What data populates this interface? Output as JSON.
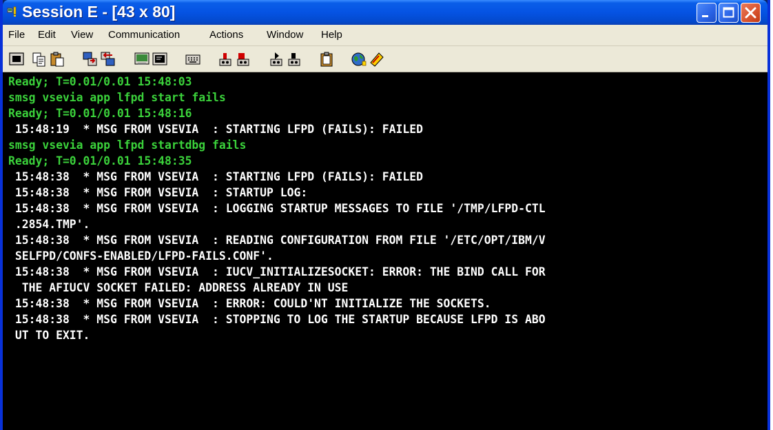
{
  "window": {
    "title": "Session E - [43 x 80]",
    "colors": {
      "title_bar": "#0553e3",
      "terminal_bg": "#000000",
      "terminal_green": "#3bd23b",
      "terminal_white": "#ffffff",
      "close_button": "#d8532e"
    }
  },
  "menu": {
    "items": [
      "File",
      "Edit",
      "View",
      "Communication",
      "Actions",
      "Window",
      "Help"
    ]
  },
  "toolbar": {
    "icons": [
      "display-icon",
      "copy-icon",
      "paste-icon",
      "send-icon",
      "receive-icon",
      "screen-setup-icon",
      "screen-icon",
      "keyboard-map-icon",
      "start-record-icon",
      "stop-record-icon",
      "play-macro-icon",
      "record-macro-icon",
      "clipboard-icon",
      "globe-icon",
      "help-icon"
    ]
  },
  "terminal": {
    "lines": [
      {
        "text": "Ready; T=0.01/0.01 15:48:03",
        "color": "green"
      },
      {
        "text": "smsg vsevia app lfpd start fails",
        "color": "green"
      },
      {
        "text": "Ready; T=0.01/0.01 15:48:16",
        "color": "green"
      },
      {
        "text": " 15:48:19  * MSG FROM VSEVIA  : STARTING LFPD (FAILS): FAILED",
        "color": "white"
      },
      {
        "text": "smsg vsevia app lfpd startdbg fails",
        "color": "green"
      },
      {
        "text": "Ready; T=0.01/0.01 15:48:35",
        "color": "green"
      },
      {
        "text": " 15:48:38  * MSG FROM VSEVIA  : STARTING LFPD (FAILS): FAILED",
        "color": "white"
      },
      {
        "text": " 15:48:38  * MSG FROM VSEVIA  : STARTUP LOG:",
        "color": "white"
      },
      {
        "text": " 15:48:38  * MSG FROM VSEVIA  : LOGGING STARTUP MESSAGES TO FILE '/TMP/LFPD-CTL",
        "color": "white"
      },
      {
        "text": " .2854.TMP'.",
        "color": "white"
      },
      {
        "text": " 15:48:38  * MSG FROM VSEVIA  : READING CONFIGURATION FROM FILE '/ETC/OPT/IBM/V",
        "color": "white"
      },
      {
        "text": " SELFPD/CONFS-ENABLED/LFPD-FAILS.CONF'.",
        "color": "white"
      },
      {
        "text": " 15:48:38  * MSG FROM VSEVIA  : IUCV_INITIALIZESOCKET: ERROR: THE BIND CALL FOR",
        "color": "white"
      },
      {
        "text": "  THE AFIUCV SOCKET FAILED: ADDRESS ALREADY IN USE",
        "color": "white"
      },
      {
        "text": " 15:48:38  * MSG FROM VSEVIA  : ERROR: COULD'NT INITIALIZE THE SOCKETS.",
        "color": "white"
      },
      {
        "text": " 15:48:38  * MSG FROM VSEVIA  : STOPPING TO LOG THE STARTUP BECAUSE LFPD IS ABO",
        "color": "white"
      },
      {
        "text": " UT TO EXIT.",
        "color": "white"
      }
    ]
  }
}
